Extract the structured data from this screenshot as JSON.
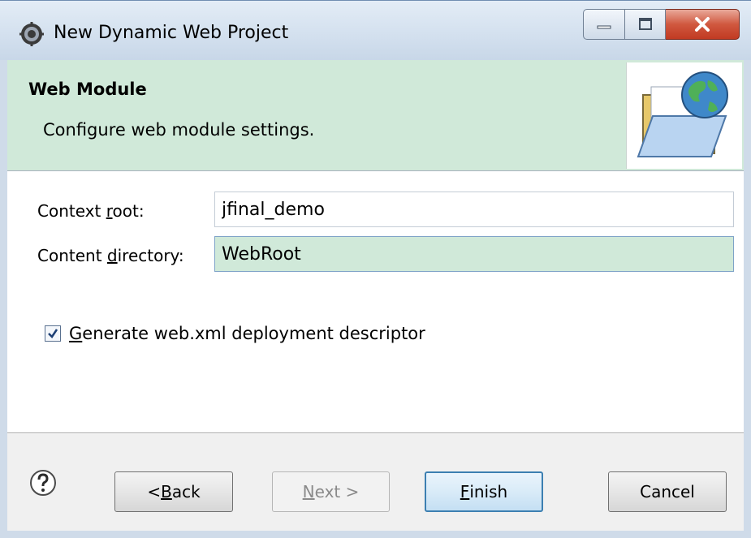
{
  "window": {
    "title": "New Dynamic Web Project"
  },
  "banner": {
    "title": "Web Module",
    "subtitle": "Configure web module settings."
  },
  "form": {
    "context_root": {
      "label_prefix": "Context ",
      "label_mnemonic": "r",
      "label_suffix": "oot:",
      "value": "jfinal_demo"
    },
    "content_directory": {
      "label_prefix": "Content ",
      "label_mnemonic": "d",
      "label_suffix": "irectory:",
      "value": "WebRoot"
    },
    "generate_descriptor": {
      "label_mnemonic": "G",
      "label_suffix": "enerate web.xml deployment descriptor",
      "checked": true
    }
  },
  "buttons": {
    "back": {
      "prefix": "< ",
      "mnemonic": "B",
      "suffix": "ack"
    },
    "next": {
      "mnemonic": "N",
      "suffix": "ext >"
    },
    "finish": {
      "mnemonic": "F",
      "suffix": "inish"
    },
    "cancel": {
      "label": "Cancel"
    }
  },
  "colors": {
    "banner_bg": "#d0e9d9",
    "focused_field_bg": "#d0e9d9",
    "default_button_border": "#3c7fb1",
    "close_button": "#c13a22"
  },
  "icons": {
    "app": "eclipse-gear-icon",
    "banner": "folder-globe-icon",
    "help": "question-mark-icon"
  }
}
